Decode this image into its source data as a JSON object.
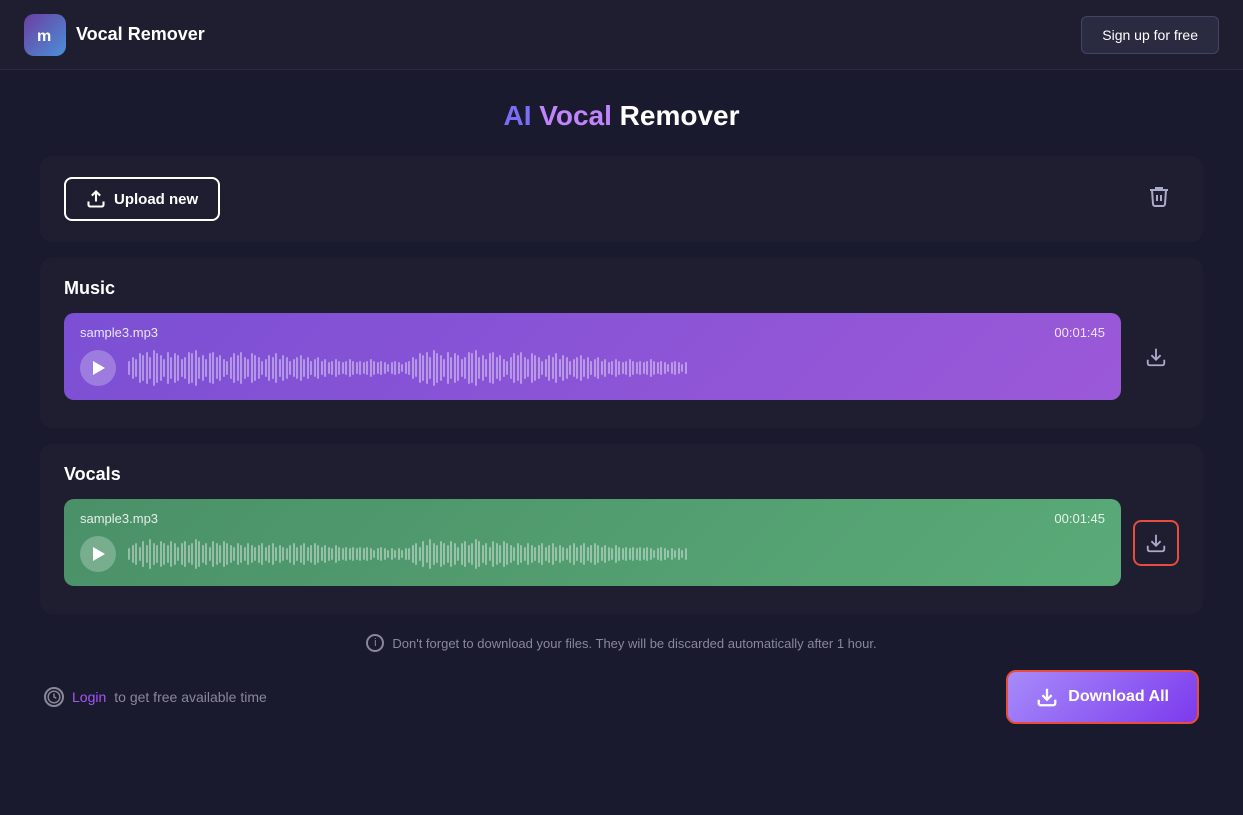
{
  "header": {
    "logo_text": "m",
    "title": "Vocal Remover",
    "signup_label": "Sign up for free"
  },
  "page": {
    "title_ai": "AI",
    "title_vocal": "Vocal",
    "title_remover": "Remover"
  },
  "upload": {
    "button_label": "Upload new",
    "delete_icon": "🗑"
  },
  "music_section": {
    "label": "Music",
    "filename": "sample3.mp3",
    "duration": "00:01:45"
  },
  "vocals_section": {
    "label": "Vocals",
    "filename": "sample3.mp3",
    "duration": "00:01:45"
  },
  "info": {
    "message": "Don't forget to download your files. They will be discarded automatically after 1 hour."
  },
  "footer": {
    "timer_hint": "Login to get free available time",
    "login_text": "Login",
    "download_all_label": "Download All"
  }
}
